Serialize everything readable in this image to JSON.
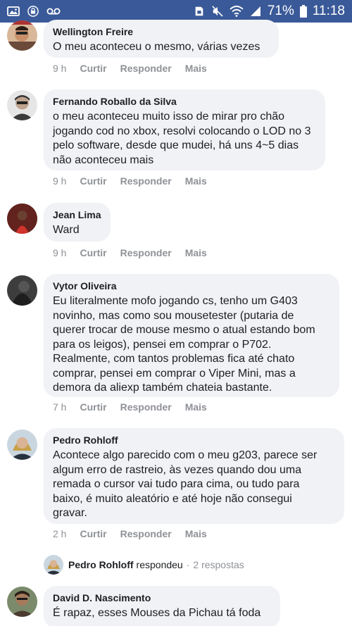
{
  "status_bar": {
    "battery": "71%",
    "time": "11:18",
    "icons": [
      "gallery-icon",
      "lock-icon",
      "voicemail-icon",
      "sim-icon",
      "mute-icon",
      "wifi-icon",
      "signal-icon",
      "battery-icon"
    ]
  },
  "comments": [
    {
      "author": "Wellington Freire",
      "text": "O meu aconteceu o mesmo, várias vezes",
      "time": "9 h",
      "actions": [
        "Curtir",
        "Responder",
        "Mais"
      ]
    },
    {
      "author": "Fernando Roballo da Silva",
      "text": "o meu aconteceu muito isso de mirar pro chão\njogando cod no xbox, resolvi colocando o LOD no 3\npelo software, desde que mudei, há uns 4~5 dias\nnão aconteceu mais",
      "time": "9 h",
      "actions": [
        "Curtir",
        "Responder",
        "Mais"
      ]
    },
    {
      "author": "Jean Lima",
      "text": "Ward",
      "time": "9 h",
      "actions": [
        "Curtir",
        "Responder",
        "Mais"
      ]
    },
    {
      "author": "Vytor Oliveira",
      "text": "Eu literalmente mofo jogando cs, tenho um G403\nnovinho, mas como sou mousetester (putaria de\nquerer trocar de mouse mesmo o atual estando bom\npara os leigos), pensei em comprar o P702.\nRealmente, com tantos problemas fica até chato\ncomprar, pensei em comprar o Viper Mini, mas a\ndemora da aliexp também chateia bastante.",
      "time": "7 h",
      "actions": [
        "Curtir",
        "Responder",
        "Mais"
      ]
    },
    {
      "author": "Pedro Rohloff",
      "text": "Acontece algo parecido com o meu g203, parece ser\nalgum erro de rastreio, às vezes quando dou uma\nremada o cursor vai tudo para cima, ou tudo para\nbaixo, é muito aleatório e até hoje não consegui\ngravar.",
      "time": "2 h",
      "actions": [
        "Curtir",
        "Responder",
        "Mais"
      ]
    },
    {
      "author": "David D. Nascimento",
      "text": "É rapaz, esses Mouses da Pichau tá foda",
      "time": "",
      "actions": []
    }
  ],
  "reply_summary": {
    "name": "Pedro Rohloff",
    "verb": "respondeu",
    "separator": "·",
    "count": "2 respostas"
  }
}
